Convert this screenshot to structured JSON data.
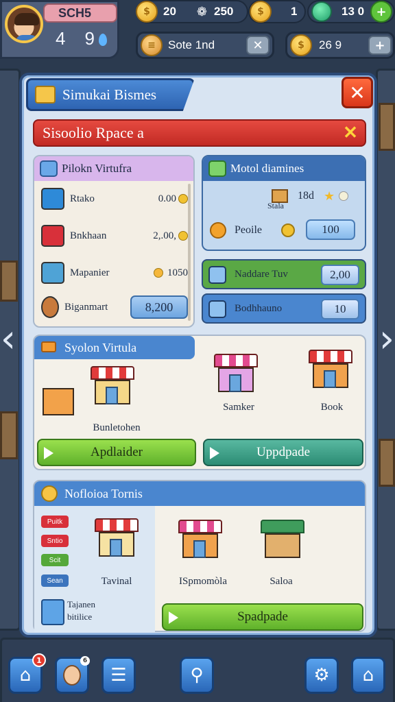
{
  "hud": {
    "player_name": "SCH5",
    "stat_a": "4",
    "stat_b": "9",
    "coins": "20",
    "gems": "250",
    "currency3": "1",
    "currency4": "13 0",
    "pill1_label": "Sote 1nd",
    "pill2_label": "26 9"
  },
  "panel": {
    "title": "Simukai Bismes",
    "close_glyph": "✕",
    "banner": "Sisoolio Rpace a",
    "banner_close": "✕"
  },
  "left_card": {
    "title": "Pilokn Virtufra",
    "items": [
      {
        "name": "Rtako",
        "price": "0.00",
        "color": "#2e8ad8"
      },
      {
        "name": "Bnkhaan",
        "price": "2,.00,",
        "color": "#d8303a"
      },
      {
        "name": "Mapanier",
        "price": "1050",
        "color": "#4fa3d6"
      },
      {
        "name": "Biganmart",
        "price": "8,200",
        "color": "#c87a3c"
      }
    ]
  },
  "right_card": {
    "title": "Motol diamines",
    "row1_value": "18d",
    "row1_sub": "Stala",
    "row2_label": "Peoile",
    "row2_value": "100"
  },
  "stat_bars": [
    {
      "label": "Naddare Tuv",
      "value": "2,00",
      "bg": "#5aa845"
    },
    {
      "label": "Bodhhauno",
      "value": "10",
      "bg": "#4a86cf"
    }
  ],
  "store": {
    "tab_title": "Syolon Virtula",
    "shop1_label": "Bunletohen",
    "shop2_label": "Samker",
    "shop3_label": "Book",
    "btn_left": "Apdlaider",
    "btn_right": "Uppdpade"
  },
  "towns": {
    "title": "Nofloioa Tornis",
    "chips": [
      "Puitk",
      "Sntio",
      "Scit",
      "Sean"
    ],
    "side_label_line1": "Tajanen",
    "side_label_line2": "bitilice",
    "town1": "Tavinal",
    "town2": "ISpmomòla",
    "town3": "Saloa",
    "action_btn": "Spadpade"
  },
  "nav": {
    "badge_count": "1",
    "badge2": "6"
  },
  "colors": {
    "panel_bg": "#d8e4f2",
    "accent_blue": "#4a86cf",
    "banner_red": "#d83a30",
    "green": "#5fb12b"
  }
}
